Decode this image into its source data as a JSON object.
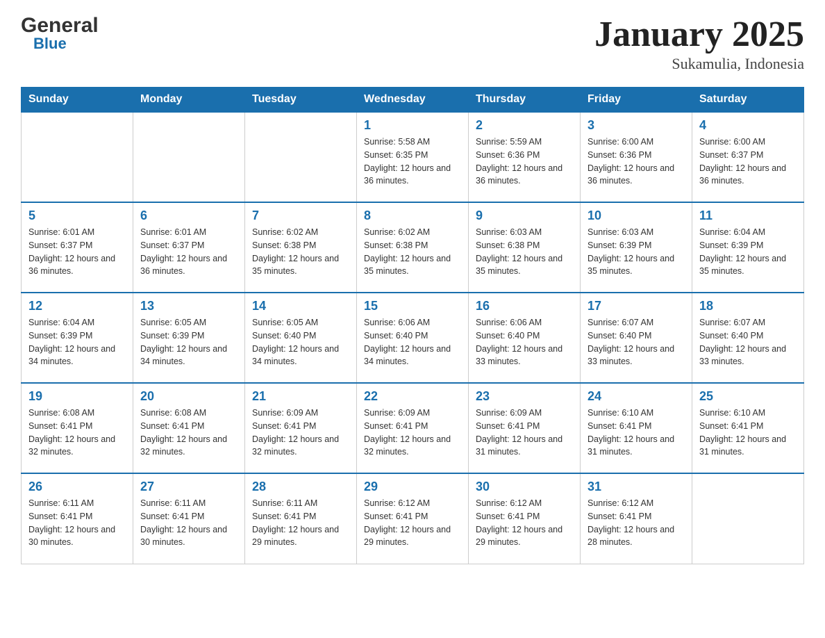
{
  "header": {
    "logo_general": "General",
    "logo_blue": "Blue",
    "title": "January 2025",
    "subtitle": "Sukamulia, Indonesia"
  },
  "days_of_week": [
    "Sunday",
    "Monday",
    "Tuesday",
    "Wednesday",
    "Thursday",
    "Friday",
    "Saturday"
  ],
  "weeks": [
    [
      {
        "day": "",
        "info": ""
      },
      {
        "day": "",
        "info": ""
      },
      {
        "day": "",
        "info": ""
      },
      {
        "day": "1",
        "info": "Sunrise: 5:58 AM\nSunset: 6:35 PM\nDaylight: 12 hours and 36 minutes."
      },
      {
        "day": "2",
        "info": "Sunrise: 5:59 AM\nSunset: 6:36 PM\nDaylight: 12 hours and 36 minutes."
      },
      {
        "day": "3",
        "info": "Sunrise: 6:00 AM\nSunset: 6:36 PM\nDaylight: 12 hours and 36 minutes."
      },
      {
        "day": "4",
        "info": "Sunrise: 6:00 AM\nSunset: 6:37 PM\nDaylight: 12 hours and 36 minutes."
      }
    ],
    [
      {
        "day": "5",
        "info": "Sunrise: 6:01 AM\nSunset: 6:37 PM\nDaylight: 12 hours and 36 minutes."
      },
      {
        "day": "6",
        "info": "Sunrise: 6:01 AM\nSunset: 6:37 PM\nDaylight: 12 hours and 36 minutes."
      },
      {
        "day": "7",
        "info": "Sunrise: 6:02 AM\nSunset: 6:38 PM\nDaylight: 12 hours and 35 minutes."
      },
      {
        "day": "8",
        "info": "Sunrise: 6:02 AM\nSunset: 6:38 PM\nDaylight: 12 hours and 35 minutes."
      },
      {
        "day": "9",
        "info": "Sunrise: 6:03 AM\nSunset: 6:38 PM\nDaylight: 12 hours and 35 minutes."
      },
      {
        "day": "10",
        "info": "Sunrise: 6:03 AM\nSunset: 6:39 PM\nDaylight: 12 hours and 35 minutes."
      },
      {
        "day": "11",
        "info": "Sunrise: 6:04 AM\nSunset: 6:39 PM\nDaylight: 12 hours and 35 minutes."
      }
    ],
    [
      {
        "day": "12",
        "info": "Sunrise: 6:04 AM\nSunset: 6:39 PM\nDaylight: 12 hours and 34 minutes."
      },
      {
        "day": "13",
        "info": "Sunrise: 6:05 AM\nSunset: 6:39 PM\nDaylight: 12 hours and 34 minutes."
      },
      {
        "day": "14",
        "info": "Sunrise: 6:05 AM\nSunset: 6:40 PM\nDaylight: 12 hours and 34 minutes."
      },
      {
        "day": "15",
        "info": "Sunrise: 6:06 AM\nSunset: 6:40 PM\nDaylight: 12 hours and 34 minutes."
      },
      {
        "day": "16",
        "info": "Sunrise: 6:06 AM\nSunset: 6:40 PM\nDaylight: 12 hours and 33 minutes."
      },
      {
        "day": "17",
        "info": "Sunrise: 6:07 AM\nSunset: 6:40 PM\nDaylight: 12 hours and 33 minutes."
      },
      {
        "day": "18",
        "info": "Sunrise: 6:07 AM\nSunset: 6:40 PM\nDaylight: 12 hours and 33 minutes."
      }
    ],
    [
      {
        "day": "19",
        "info": "Sunrise: 6:08 AM\nSunset: 6:41 PM\nDaylight: 12 hours and 32 minutes."
      },
      {
        "day": "20",
        "info": "Sunrise: 6:08 AM\nSunset: 6:41 PM\nDaylight: 12 hours and 32 minutes."
      },
      {
        "day": "21",
        "info": "Sunrise: 6:09 AM\nSunset: 6:41 PM\nDaylight: 12 hours and 32 minutes."
      },
      {
        "day": "22",
        "info": "Sunrise: 6:09 AM\nSunset: 6:41 PM\nDaylight: 12 hours and 32 minutes."
      },
      {
        "day": "23",
        "info": "Sunrise: 6:09 AM\nSunset: 6:41 PM\nDaylight: 12 hours and 31 minutes."
      },
      {
        "day": "24",
        "info": "Sunrise: 6:10 AM\nSunset: 6:41 PM\nDaylight: 12 hours and 31 minutes."
      },
      {
        "day": "25",
        "info": "Sunrise: 6:10 AM\nSunset: 6:41 PM\nDaylight: 12 hours and 31 minutes."
      }
    ],
    [
      {
        "day": "26",
        "info": "Sunrise: 6:11 AM\nSunset: 6:41 PM\nDaylight: 12 hours and 30 minutes."
      },
      {
        "day": "27",
        "info": "Sunrise: 6:11 AM\nSunset: 6:41 PM\nDaylight: 12 hours and 30 minutes."
      },
      {
        "day": "28",
        "info": "Sunrise: 6:11 AM\nSunset: 6:41 PM\nDaylight: 12 hours and 29 minutes."
      },
      {
        "day": "29",
        "info": "Sunrise: 6:12 AM\nSunset: 6:41 PM\nDaylight: 12 hours and 29 minutes."
      },
      {
        "day": "30",
        "info": "Sunrise: 6:12 AM\nSunset: 6:41 PM\nDaylight: 12 hours and 29 minutes."
      },
      {
        "day": "31",
        "info": "Sunrise: 6:12 AM\nSunset: 6:41 PM\nDaylight: 12 hours and 28 minutes."
      },
      {
        "day": "",
        "info": ""
      }
    ]
  ],
  "colors": {
    "header_bg": "#1a6fad",
    "header_text": "#ffffff",
    "day_number": "#1a6fad",
    "border": "#cccccc",
    "row_top_border": "#1a6fad"
  }
}
